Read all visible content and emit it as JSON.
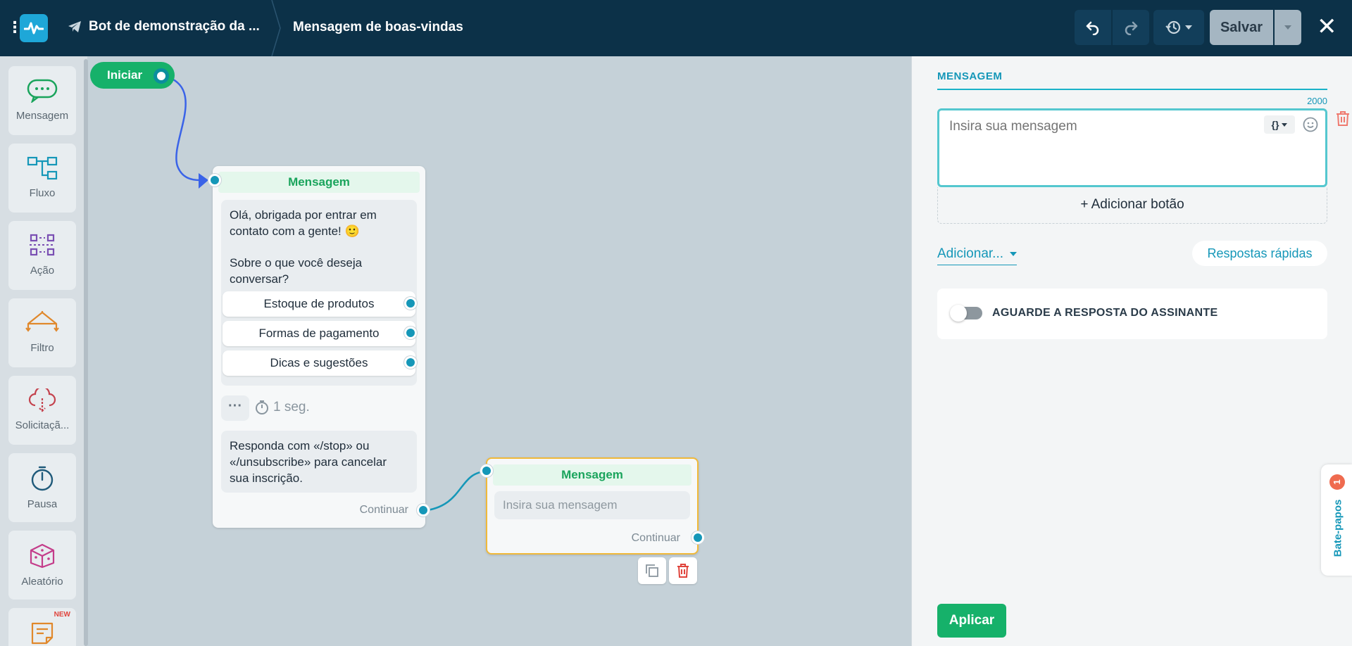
{
  "header": {
    "bot_name": "Bot de demonstração da ...",
    "current_step": "Mensagem de boas-vindas",
    "save_label": "Salvar",
    "close_label": "✕"
  },
  "toolbar": {
    "items": [
      {
        "label": "Mensagem",
        "icon": "chat-bubble-icon",
        "color": "#1aa45c"
      },
      {
        "label": "Fluxo",
        "icon": "flow-icon",
        "color": "#1597b8"
      },
      {
        "label": "Ação",
        "icon": "action-icon",
        "color": "#7a4fb3"
      },
      {
        "label": "Filtro",
        "icon": "filter-icon",
        "color": "#e0882b"
      },
      {
        "label": "Solicitaçã...",
        "icon": "cloud-request-icon",
        "color": "#c4434e"
      },
      {
        "label": "Pausa",
        "icon": "timer-icon",
        "color": "#1f5a7a"
      },
      {
        "label": "Aleatório",
        "icon": "dice-icon",
        "color": "#c43c8a"
      },
      {
        "label": "",
        "icon": "note-icon",
        "color": "#e0882b",
        "badge": "NEW"
      }
    ]
  },
  "canvas": {
    "start_label": "Iniciar",
    "node1": {
      "title": "Mensagem",
      "text_line1": "Olá, obrigada por entrar em contato com a gente! 🙂",
      "text_line2": "Sobre o que você deseja conversar?",
      "buttons": [
        "Estoque de produtos",
        "Formas de pagamento",
        "Dicas e sugestões"
      ],
      "delay": "1 seg.",
      "unsubscribe_text": "Responda com «/stop» ou «/unsubscribe» para cancelar sua inscrição.",
      "continue_label": "Continuar"
    },
    "node2": {
      "title": "Mensagem",
      "placeholder": "Insira sua mensagem",
      "continue_label": "Continuar"
    }
  },
  "panel": {
    "section_title": "MENSAGEM",
    "char_counter": "2000",
    "message_placeholder": "Insira sua mensagem",
    "variables_label": "{}",
    "add_button_label": "+ Adicionar botão",
    "add_menu_label": "Adicionar...",
    "quick_replies_label": "Respostas rápidas",
    "wait_reply_label": "AGUARDE A RESPOSTA DO ASSINANTE",
    "apply_label": "Aplicar"
  },
  "chats_tab": {
    "label": "Bate-papos",
    "badge": "1"
  },
  "colors": {
    "topbar": "#0c3148",
    "accent": "#1597b8",
    "green": "#16b16a"
  }
}
